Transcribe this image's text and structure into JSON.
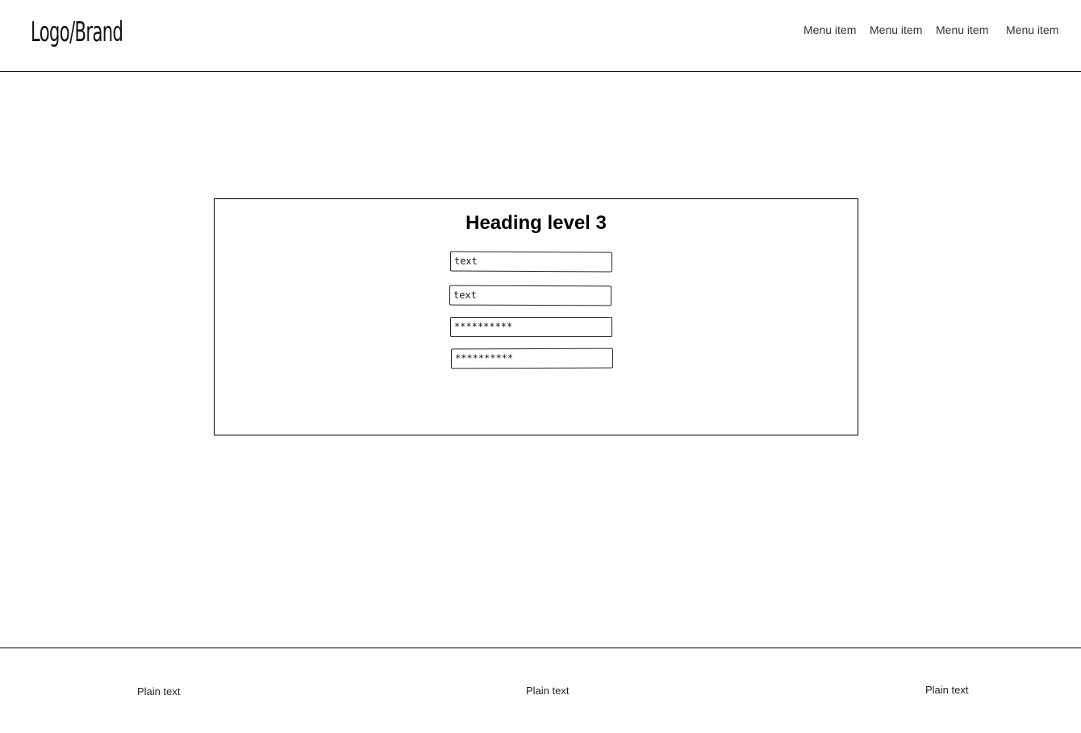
{
  "header": {
    "logo": "Logo/Brand",
    "menu": [
      {
        "label": "Menu item"
      },
      {
        "label": "Menu item"
      },
      {
        "label": "Menu item"
      },
      {
        "label": "Menu item"
      }
    ]
  },
  "form": {
    "heading": "Heading level 3",
    "fields": [
      {
        "value": "text"
      },
      {
        "value": "text"
      },
      {
        "value": "**********"
      },
      {
        "value": "**********"
      }
    ]
  },
  "footer": {
    "items": [
      {
        "label": "Plain text"
      },
      {
        "label": "Plain text"
      },
      {
        "label": "Plain text"
      }
    ]
  }
}
